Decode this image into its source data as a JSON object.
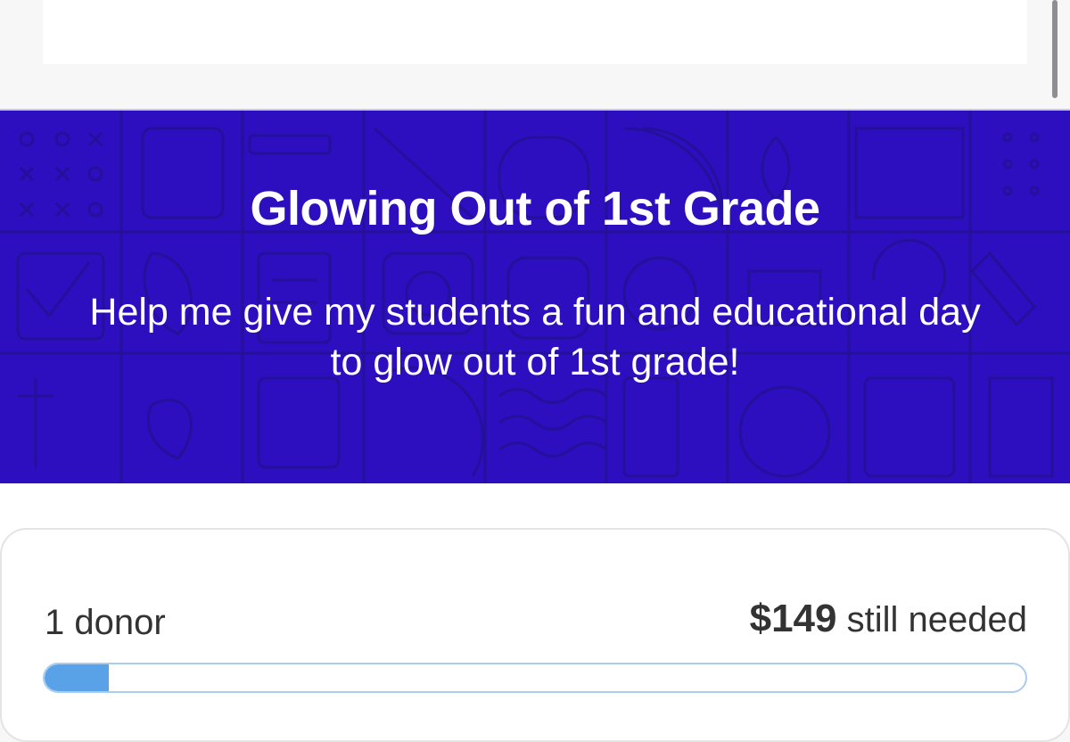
{
  "project": {
    "title": "Glowing Out of 1st Grade",
    "subtitle": "Help me give my students a fun and educational day to glow out of 1st grade!"
  },
  "funding": {
    "donors_label": "1 donor",
    "amount_needed": "$149",
    "still_needed_label": "still needed",
    "progress_fraction": 0.065
  },
  "colors": {
    "hero_background": "#2e0fbf",
    "progress_fill": "#5aa2e8",
    "progress_border": "#a9cdf0"
  }
}
